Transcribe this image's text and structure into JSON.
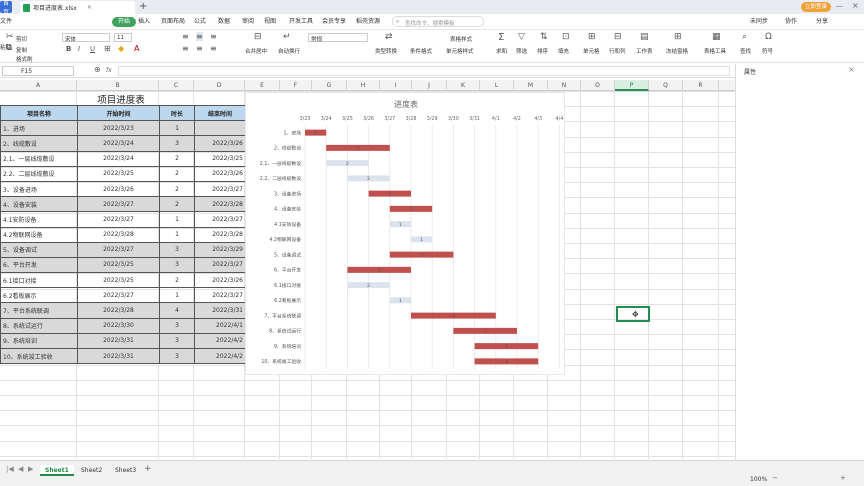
{
  "titlebar": {
    "app_tab": "首页",
    "file_tab": "项目进度表.xlsx",
    "login": "立即登录"
  },
  "menubar": {
    "file": "文件",
    "items": [
      "开始",
      "插入",
      "页面布局",
      "公式",
      "数据",
      "审阅",
      "视图",
      "开发工具",
      "会员专享",
      "稻壳资源"
    ],
    "search": "查找命令、搜索模板",
    "right": [
      "未同步",
      "协作",
      "分享"
    ]
  },
  "ribbon": {
    "clipboard": [
      "剪切",
      "复制",
      "格式刷"
    ],
    "paste": "粘贴",
    "font_name": "宋体",
    "font_size": "11",
    "merge": "合并居中",
    "wrap": "自动换行",
    "number_format": "常规",
    "convert": "类型转换",
    "cond_format": "条件格式",
    "table_style": "表格样式",
    "cell_style": "单元格样式",
    "sum": "求和",
    "filter": "筛选",
    "sort": "排序",
    "fill": "填充",
    "cell": "单元格",
    "rowcol": "行和列",
    "worksheet": "工作表",
    "freeze": "冻结窗格",
    "table_tools": "表格工具",
    "find": "查找",
    "symbol": "符号"
  },
  "formulabar": {
    "cell_ref": "F15",
    "fx": "fx"
  },
  "columns": [
    "A",
    "B",
    "C",
    "D",
    "E",
    "F",
    "G",
    "H",
    "I",
    "J",
    "K",
    "L",
    "M",
    "N",
    "O",
    "P",
    "Q",
    "R"
  ],
  "selected_column": "P",
  "side_panel": {
    "title": "属性"
  },
  "sheet": {
    "title": "项目进度表",
    "headers": [
      "项目名称",
      "开始时间",
      "时长",
      "结束时间"
    ],
    "rows": [
      [
        "1、进场",
        "2022/3/23",
        "1",
        ""
      ],
      [
        "2、线缆敷设",
        "2022/3/24",
        "3",
        "2022/3/26"
      ],
      [
        "2.1、一层线缆敷设",
        "2022/3/24",
        "2",
        "2022/3/25"
      ],
      [
        "2.2、二层线缆敷设",
        "2022/3/25",
        "2",
        "2022/3/26"
      ],
      [
        "3、设备进场",
        "2022/3/26",
        "2",
        "2022/3/27"
      ],
      [
        "4、设备安装",
        "2022/3/27",
        "2",
        "2022/3/28"
      ],
      [
        "4.1安防设备",
        "2022/3/27",
        "1",
        "2022/3/27"
      ],
      [
        "4.2物联网设备",
        "2022/3/28",
        "1",
        "2022/3/28"
      ],
      [
        "5、设备调试",
        "2022/3/27",
        "3",
        "2022/3/29"
      ],
      [
        "6、平台开发",
        "2022/3/25",
        "3",
        "2022/3/27"
      ],
      [
        "6.1接口对接",
        "2022/3/25",
        "2",
        "2022/3/26"
      ],
      [
        "6.2看板展示",
        "2022/3/27",
        "1",
        "2022/3/27"
      ],
      [
        "7、平台系统联调",
        "2022/3/28",
        "4",
        "2022/3/31"
      ],
      [
        "8、系统试运行",
        "2022/3/30",
        "3",
        "2022/4/1"
      ],
      [
        "9、系统培训",
        "2022/3/31",
        "3",
        "2022/4/2"
      ],
      [
        "10、系统竣工验收",
        "2022/3/31",
        "3",
        "2022/4/2"
      ]
    ],
    "shaded": [
      true,
      true,
      false,
      false,
      false,
      true,
      false,
      false,
      true,
      true,
      false,
      false,
      true,
      true,
      true,
      true
    ]
  },
  "chart_data": {
    "type": "bar",
    "title": "进度表",
    "x_tick_labels": [
      "3/23",
      "3/24",
      "3/25",
      "3/26",
      "3/27",
      "3/28",
      "3/29",
      "3/30",
      "3/31",
      "4/1",
      "4/2",
      "4/3",
      "4/4"
    ],
    "categories": [
      "1、进场",
      "2、线缆敷设",
      "2.1、一层线缆敷设",
      "2.2、二层线缆敷设",
      "3、设备进场",
      "4、设备安装",
      "4.1安防设备",
      "4.2物联网设备",
      "5、设备调试",
      "6、平台开发",
      "6.1接口对接",
      "6.2看板展示",
      "7、平台系统联调",
      "8、系统试运行",
      "9、系统培训",
      "10、系统竣工验收"
    ],
    "series": [
      {
        "values": [
          "3/23",
          "3/24",
          "3/24",
          "3/25",
          "3/26",
          "3/27",
          "3/27",
          "3/28",
          "3/27",
          "3/25",
          "3/25",
          "3/27",
          "3/28",
          "3/30",
          "3/31",
          "3/31"
        ]
      },
      {
        "values": [
          1,
          3,
          2,
          2,
          2,
          2,
          1,
          1,
          3,
          3,
          2,
          1,
          4,
          3,
          3,
          3
        ]
      }
    ],
    "bar_colors": [
      "#c0504d",
      "#c0504d",
      "#dde3ee",
      "#dde3ee",
      "#c0504d",
      "#c0504d",
      "#dde3ee",
      "#dde3ee",
      "#c0504d",
      "#c0504d",
      "#dde3ee",
      "#dde3ee",
      "#c0504d",
      "#c0504d",
      "#c0504d",
      "#c0504d"
    ],
    "xlim": [
      "3/23",
      "4/4"
    ],
    "orientation": "horizontal",
    "grid": true
  },
  "sheets": [
    "Sheet1",
    "Sheet2",
    "Sheet3"
  ],
  "statusbar": {
    "zoom": "100%"
  },
  "colors": {
    "accent": "#1f8a4a",
    "header_fill": "#bdd7ee",
    "shade_fill": "#d9d9d9",
    "bar_red": "#c0504d",
    "bar_light": "#dde3ee"
  }
}
